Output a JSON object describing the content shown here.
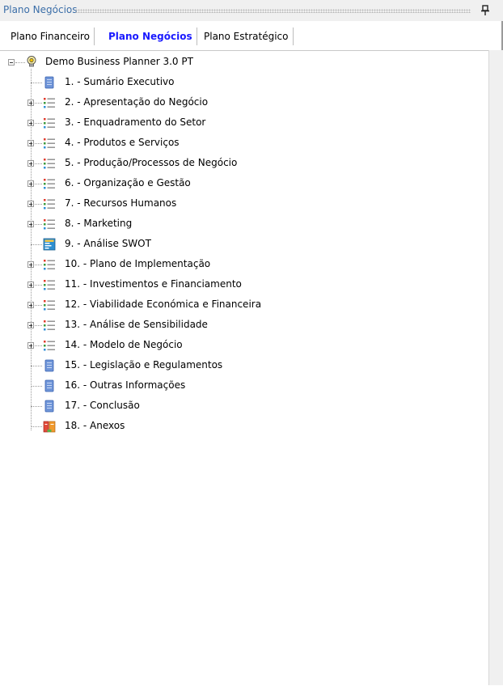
{
  "panel": {
    "title": "Plano Negócios"
  },
  "tabs": [
    {
      "label": "Plano Financeiro"
    },
    {
      "label": "Plano Negócios"
    },
    {
      "label": "Plano Estratégico"
    }
  ],
  "tree": {
    "root": {
      "label": "Demo Business Planner 3.0 PT",
      "icon": "lightbulb-icon",
      "expanded": true
    },
    "items": [
      {
        "label": "1. - Sumário Executivo",
        "icon": "document-icon",
        "expandable": false
      },
      {
        "label": "2. - Apresentação do Negócio",
        "icon": "list-icon",
        "expandable": true
      },
      {
        "label": "3. - Enquadramento do Setor",
        "icon": "list-icon",
        "expandable": true
      },
      {
        "label": "4. - Produtos e Serviços",
        "icon": "list-icon",
        "expandable": true
      },
      {
        "label": "5. - Produção/Processos de Negócio",
        "icon": "list-icon",
        "expandable": true
      },
      {
        "label": "6. - Organização e Gestão",
        "icon": "list-icon",
        "expandable": true
      },
      {
        "label": "7. - Recursos Humanos",
        "icon": "list-icon",
        "expandable": true
      },
      {
        "label": "8. - Marketing",
        "icon": "list-icon",
        "expandable": true
      },
      {
        "label": "9. - Análise SWOT",
        "icon": "swot-icon",
        "expandable": false
      },
      {
        "label": "10. - Plano de Implementação",
        "icon": "list-icon",
        "expandable": true
      },
      {
        "label": "11. - Investimentos e Financiamento",
        "icon": "list-icon",
        "expandable": true
      },
      {
        "label": "12. - Viabilidade Económica e Financeira",
        "icon": "list-icon",
        "expandable": true
      },
      {
        "label": "13. - Análise de Sensibilidade",
        "icon": "list-icon",
        "expandable": true
      },
      {
        "label": "14. - Modelo de Negócio",
        "icon": "list-icon",
        "expandable": true
      },
      {
        "label": "15. - Legislação e Regulamentos",
        "icon": "document-icon",
        "expandable": false
      },
      {
        "label": "16. - Outras Informações",
        "icon": "document-icon",
        "expandable": false
      },
      {
        "label": "17. - Conclusão",
        "icon": "document-icon",
        "expandable": false
      },
      {
        "label": "18. - Anexos",
        "icon": "attachments-icon",
        "expandable": false
      }
    ]
  }
}
